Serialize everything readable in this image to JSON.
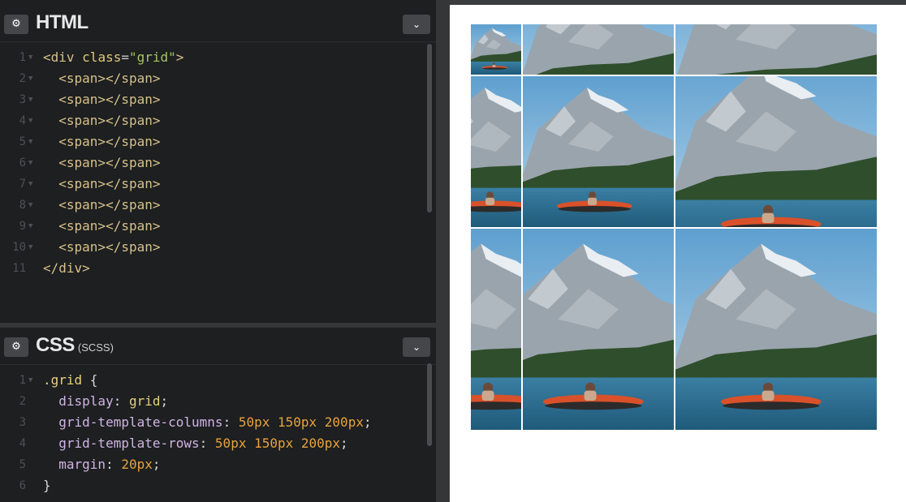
{
  "html_panel": {
    "title": "HTML",
    "settings_icon": "gear-icon",
    "collapse_icon": "chevron-down-icon",
    "lines": [
      {
        "n": "1",
        "parts": [
          [
            "tag",
            "<div "
          ],
          [
            "attr",
            "class"
          ],
          [
            "punc",
            "="
          ],
          [
            "str",
            "\"grid\""
          ],
          [
            "tag",
            ">"
          ]
        ]
      },
      {
        "n": "2",
        "parts": [
          [
            "tag",
            "  <span></span>"
          ]
        ]
      },
      {
        "n": "3",
        "parts": [
          [
            "tag",
            "  <span></span>"
          ]
        ]
      },
      {
        "n": "4",
        "parts": [
          [
            "tag",
            "  <span></span>"
          ]
        ]
      },
      {
        "n": "5",
        "parts": [
          [
            "tag",
            "  <span></span>"
          ]
        ]
      },
      {
        "n": "6",
        "parts": [
          [
            "tag",
            "  <span></span>"
          ]
        ]
      },
      {
        "n": "7",
        "parts": [
          [
            "tag",
            "  <span></span>"
          ]
        ]
      },
      {
        "n": "8",
        "parts": [
          [
            "tag",
            "  <span></span>"
          ]
        ]
      },
      {
        "n": "9",
        "parts": [
          [
            "tag",
            "  <span></span>"
          ]
        ]
      },
      {
        "n": "10",
        "parts": [
          [
            "tag",
            "  <span></span>"
          ]
        ]
      },
      {
        "n": "11",
        "parts": [
          [
            "tag",
            "</div>"
          ]
        ]
      }
    ]
  },
  "css_panel": {
    "title": "CSS",
    "subtitle": "(SCSS)",
    "settings_icon": "gear-icon",
    "collapse_icon": "chevron-down-icon",
    "lines": [
      {
        "n": "1",
        "parts": [
          [
            "sel",
            ".grid "
          ],
          [
            "plain",
            "{"
          ]
        ]
      },
      {
        "n": "2",
        "parts": [
          [
            "prop",
            "  display"
          ],
          [
            "plain",
            ": "
          ],
          [
            "val",
            "grid"
          ],
          [
            "plain",
            ";"
          ]
        ]
      },
      {
        "n": "3",
        "parts": [
          [
            "prop",
            "  grid-template-columns"
          ],
          [
            "plain",
            ": "
          ],
          [
            "num",
            "50px 150px 200px"
          ],
          [
            "plain",
            ";"
          ]
        ]
      },
      {
        "n": "4",
        "parts": [
          [
            "prop",
            "  grid-template-rows"
          ],
          [
            "plain",
            ": "
          ],
          [
            "num",
            "50px 150px 200px"
          ],
          [
            "plain",
            ";"
          ]
        ]
      },
      {
        "n": "5",
        "parts": [
          [
            "prop",
            "  margin"
          ],
          [
            "plain",
            ": "
          ],
          [
            "num",
            "20px"
          ],
          [
            "plain",
            ";"
          ]
        ]
      },
      {
        "n": "6",
        "parts": [
          [
            "plain",
            "}"
          ]
        ]
      }
    ]
  },
  "preview": {
    "image_subject": "mountain-lake-kayak-photo",
    "cell_count": 9
  },
  "colors": {
    "editor_bg": "#1d1f20",
    "tag": "#d7c08a",
    "string": "#a6c46a",
    "number": "#e8a33d"
  }
}
